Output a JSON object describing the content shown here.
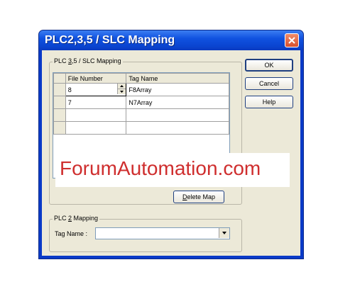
{
  "window": {
    "title": "PLC2,3,5 / SLC Mapping"
  },
  "slc_group": {
    "label_prefix": "PLC ",
    "label_hotkey": "3",
    "label_suffix": ",5 / SLC Mapping"
  },
  "grid": {
    "headers": [
      "File Number",
      "Tag Name"
    ],
    "rows": [
      {
        "file_number": "8",
        "tag_name": "F8Array"
      },
      {
        "file_number": "7",
        "tag_name": "N7Array"
      },
      {
        "file_number": "",
        "tag_name": ""
      },
      {
        "file_number": "",
        "tag_name": ""
      }
    ]
  },
  "buttons": {
    "ok": "OK",
    "cancel": "Cancel",
    "help": "Help",
    "delete_map_hotkey": "D",
    "delete_map_rest": "elete Map"
  },
  "plc2_group": {
    "label_prefix": "PLC ",
    "label_hotkey": "2",
    "label_suffix": " Mapping",
    "tag_name_label": "Tag Name :",
    "tag_name_value": ""
  },
  "watermark": {
    "text": "ForumAutomation.com"
  },
  "colors": {
    "titlebar": "#0a44d0",
    "dialog_bg": "#ece9d8",
    "watermark": "#cf2e2e"
  }
}
